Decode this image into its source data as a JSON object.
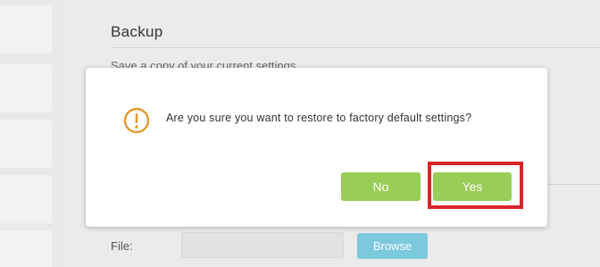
{
  "section": {
    "title": "Backup",
    "description": "Save a copy of your current settings."
  },
  "file_row": {
    "label": "File:",
    "browse_label": "Browse"
  },
  "dialog": {
    "icon": "warning-circle-icon",
    "message": "Are you sure you want to restore to factory default settings?",
    "no_label": "No",
    "yes_label": "Yes"
  },
  "colors": {
    "button_green": "#98cd58",
    "browse_blue": "#7cc8dc",
    "warning_orange": "#e3992f",
    "highlight_red": "#d8262c"
  }
}
